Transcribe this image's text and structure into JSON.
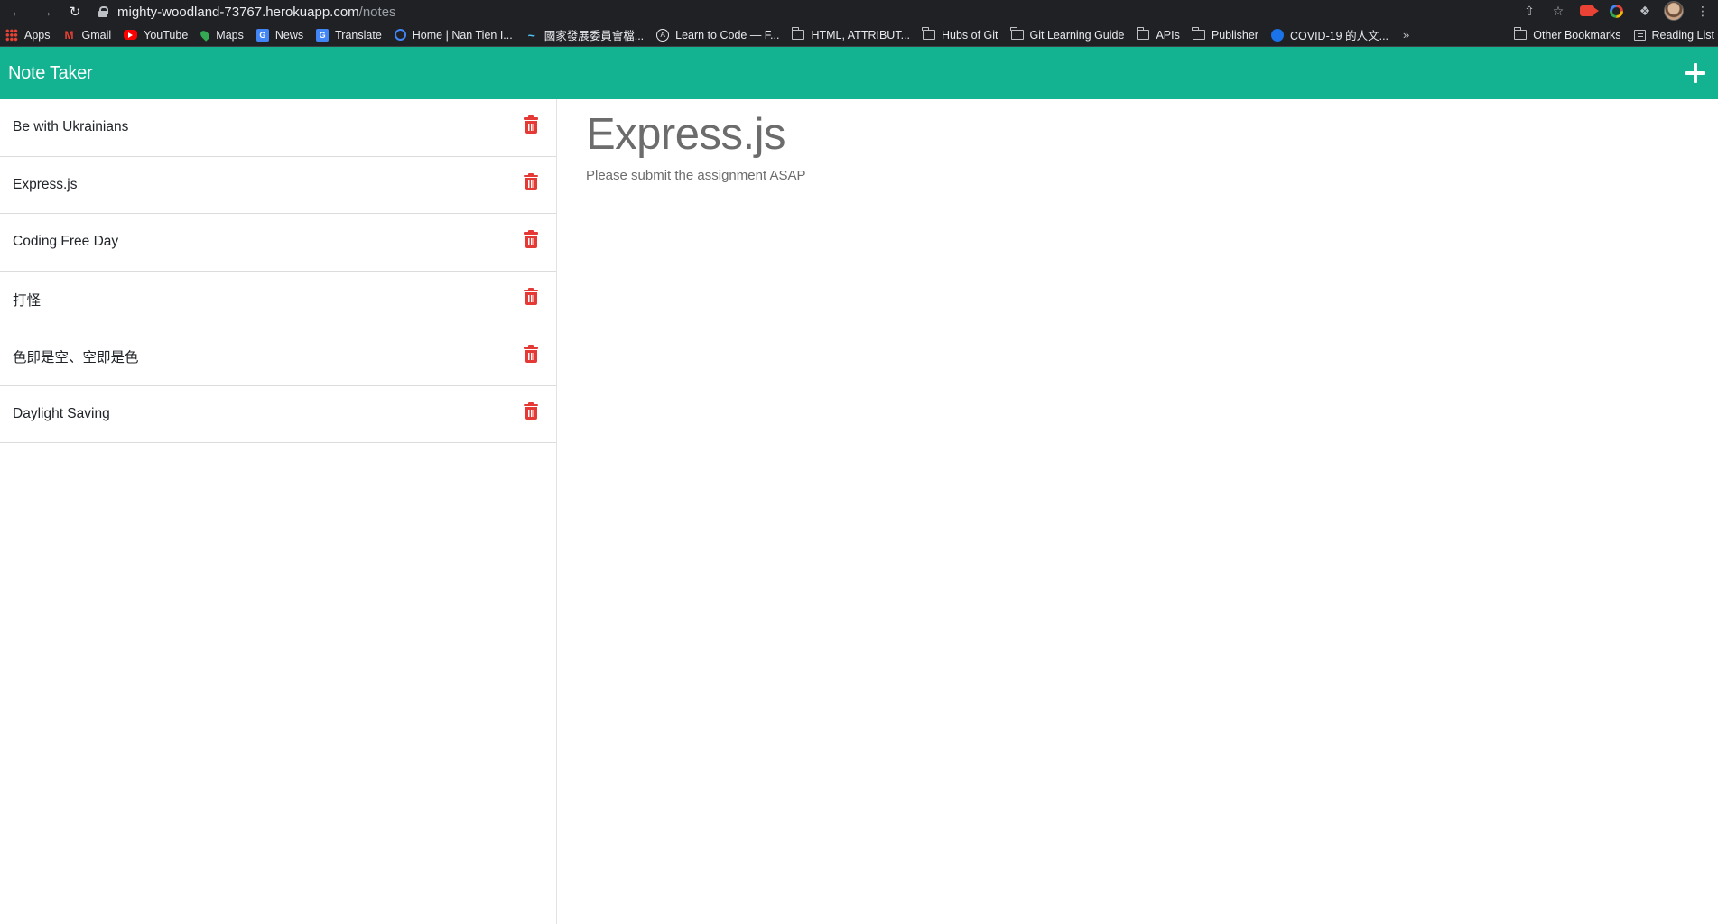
{
  "browser": {
    "url_host": "mighty-woodland-73767.herokuapp.com",
    "url_path": "/notes",
    "bookmarks": [
      {
        "label": "Apps",
        "icon": "apps-grid-icon"
      },
      {
        "label": "Gmail",
        "icon": "gmail-icon"
      },
      {
        "label": "YouTube",
        "icon": "youtube-icon"
      },
      {
        "label": "Maps",
        "icon": "maps-icon"
      },
      {
        "label": "News",
        "icon": "news-icon"
      },
      {
        "label": "Translate",
        "icon": "translate-icon"
      },
      {
        "label": "Home | Nan Tien I...",
        "icon": "site-icon"
      },
      {
        "label": "國家發展委員會檔...",
        "icon": "site-icon"
      },
      {
        "label": "Learn to Code — F...",
        "icon": "site-icon"
      },
      {
        "label": "HTML, ATTRIBUT...",
        "icon": "folder-icon"
      },
      {
        "label": "Hubs of Git",
        "icon": "folder-icon"
      },
      {
        "label": "Git Learning Guide",
        "icon": "folder-icon"
      },
      {
        "label": "APIs",
        "icon": "folder-icon"
      },
      {
        "label": "Publisher",
        "icon": "folder-icon"
      },
      {
        "label": "COVID-19 的人文...",
        "icon": "globe-icon"
      }
    ],
    "more_label": "»",
    "other_bookmarks": "Other Bookmarks",
    "reading_list": "Reading List"
  },
  "app": {
    "brand": "Note Taker",
    "accent_color": "#13b392",
    "delete_color": "#e53935"
  },
  "notes": [
    {
      "title": "Be with Ukrainians"
    },
    {
      "title": "Express.js"
    },
    {
      "title": "Coding Free Day"
    },
    {
      "title": "打怪"
    },
    {
      "title": "色即是空、空即是色"
    },
    {
      "title": "Daylight Saving"
    }
  ],
  "active_note": {
    "title": "Express.js",
    "text": "Please submit the assignment ASAP"
  }
}
